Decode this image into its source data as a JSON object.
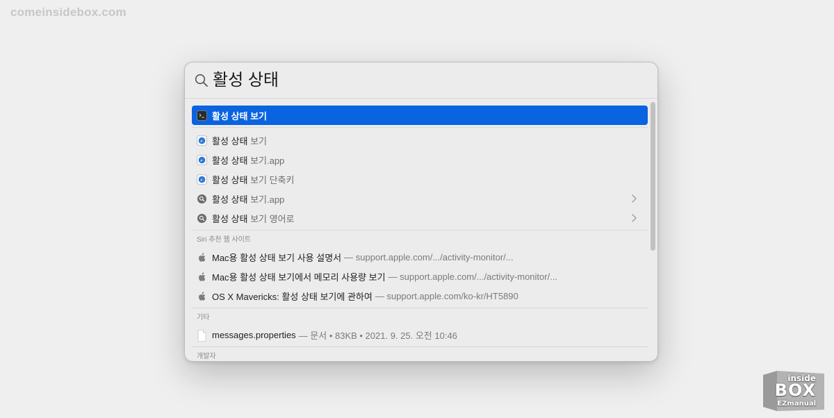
{
  "watermark": "comeinsidebox.com",
  "search": {
    "query": "활성 상태"
  },
  "results": {
    "top_hit": {
      "label": "활성 상태 보기",
      "icon": "terminal-app-icon"
    },
    "items": [
      {
        "label": "활성 상태",
        "suffix": " 보기",
        "icon": "safari-icon",
        "chevron": false
      },
      {
        "label": "활성 상태",
        "suffix": " 보기.app",
        "icon": "safari-icon",
        "chevron": false
      },
      {
        "label": "활성 상태",
        "suffix": " 보기 단축키",
        "icon": "safari-icon",
        "chevron": false
      },
      {
        "label": "활성 상태",
        "suffix": " 보기.app",
        "icon": "search-suggestion-icon",
        "chevron": true
      },
      {
        "label": "활성 상태",
        "suffix": " 보기 영어로",
        "icon": "search-suggestion-icon",
        "chevron": true
      }
    ]
  },
  "siri_section": {
    "title": "Siri 추천 웹 사이트",
    "items": [
      {
        "label": "Mac용 활성 상태 보기 사용 설명서",
        "detail": "— support.apple.com/.../activity-monitor/..."
      },
      {
        "label": "Mac용 활성 상태 보기에서 메모리 사용량 보기",
        "detail": "— support.apple.com/.../activity-monitor/..."
      },
      {
        "label": "OS X Mavericks: 활성 상태 보기에 관하여",
        "detail": "— support.apple.com/ko-kr/HT5890"
      }
    ]
  },
  "other_section": {
    "title": "기타",
    "items": [
      {
        "label": "messages.properties",
        "detail": "— 문서 • 83KB • 2021. 9. 25. 오전 10:46"
      }
    ]
  },
  "developer_section": {
    "title": "개발자"
  },
  "logo": {
    "line1": "inside",
    "line2": "BOX",
    "line3": "EZmanual"
  },
  "colors": {
    "selection": "#0a63e0",
    "background": "#efefef",
    "panel": "#ececec"
  }
}
